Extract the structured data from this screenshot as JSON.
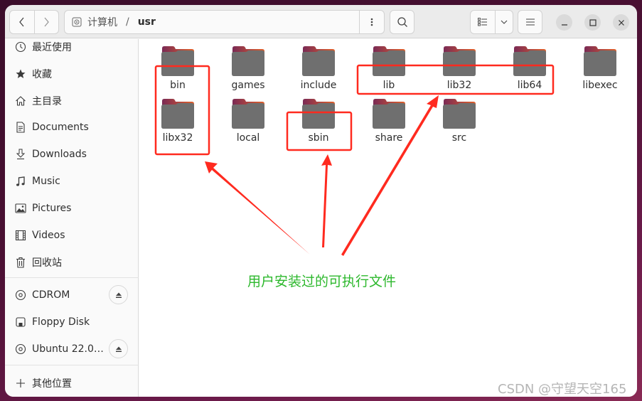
{
  "window": {
    "path": {
      "root": "计算机",
      "separator": "/",
      "current": "usr"
    }
  },
  "sidebar": {
    "items": [
      {
        "label": "最近使用",
        "icon": "clock-icon"
      },
      {
        "label": "收藏",
        "icon": "star-icon"
      },
      {
        "label": "主目录",
        "icon": "home-icon"
      },
      {
        "label": "Documents",
        "icon": "document-icon"
      },
      {
        "label": "Downloads",
        "icon": "download-icon"
      },
      {
        "label": "Music",
        "icon": "music-icon"
      },
      {
        "label": "Pictures",
        "icon": "picture-icon"
      },
      {
        "label": "Videos",
        "icon": "video-icon"
      },
      {
        "label": "回收站",
        "icon": "trash-icon"
      }
    ],
    "devices": [
      {
        "label": "CDROM",
        "icon": "disc-icon",
        "eject": true
      },
      {
        "label": "Floppy Disk",
        "icon": "floppy-icon",
        "eject": false
      },
      {
        "label": "Ubuntu 22.0…",
        "icon": "disc-icon",
        "eject": true
      }
    ],
    "other": {
      "label": "其他位置",
      "icon": "plus-icon"
    }
  },
  "folders": [
    "bin",
    "games",
    "include",
    "lib",
    "lib32",
    "lib64",
    "libexec",
    "libx32",
    "local",
    "sbin",
    "share",
    "src"
  ],
  "annotation": {
    "text": "用户安装过的可执行文件",
    "highlighted": [
      "bin",
      "libx32",
      "sbin",
      "lib",
      "lib32",
      "lib64"
    ],
    "box_color": "#ff2a1f",
    "text_color": "#2db82d"
  },
  "watermark": "CSDN @守望天空165"
}
